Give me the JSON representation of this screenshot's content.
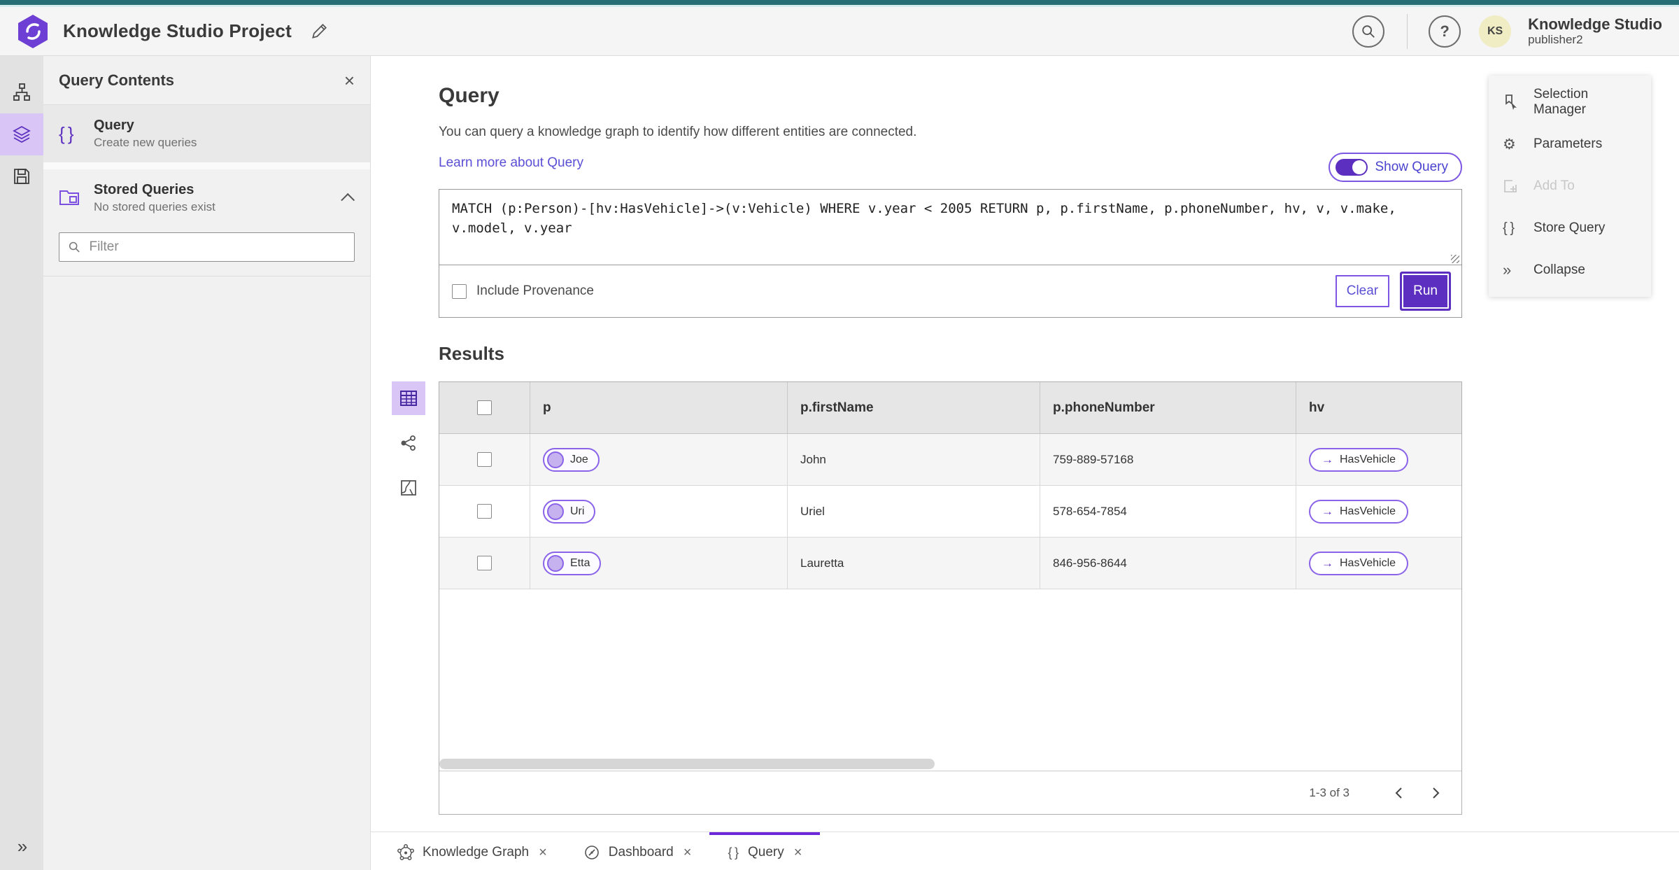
{
  "header": {
    "app_title": "Knowledge Studio Project",
    "product_name": "Knowledge Studio",
    "user_name": "publisher2",
    "avatar_initials": "KS",
    "help_glyph": "?"
  },
  "left_panel": {
    "title": "Query Contents",
    "query_item": {
      "label": "Query",
      "sublabel": "Create new queries"
    },
    "stored_item": {
      "label": "Stored Queries",
      "sublabel": "No stored queries exist"
    },
    "filter_placeholder": "Filter"
  },
  "query": {
    "title": "Query",
    "description": "You can query a knowledge graph to identify how different entities are connected.",
    "learn_more_label": "Learn more about Query",
    "show_query_label": "Show Query",
    "text": "MATCH (p:Person)-[hv:HasVehicle]->(v:Vehicle) WHERE v.year < 2005 RETURN p, p.firstName, p.phoneNumber, hv, v, v.make, v.model, v.year",
    "include_provenance_label": "Include Provenance",
    "clear_label": "Clear",
    "run_label": "Run"
  },
  "results": {
    "title": "Results",
    "columns": {
      "c1": "p",
      "c2": "p.firstName",
      "c3": "p.phoneNumber",
      "c4": "hv"
    },
    "rows": [
      {
        "p": "Joe",
        "firstName": "John",
        "phone": "759-889-57168",
        "hv": "HasVehicle"
      },
      {
        "p": "Uri",
        "firstName": "Uriel",
        "phone": "578-654-7854",
        "hv": "HasVehicle"
      },
      {
        "p": "Etta",
        "firstName": "Lauretta",
        "phone": "846-956-8644",
        "hv": "HasVehicle"
      }
    ],
    "pagination_label": "1-3 of 3"
  },
  "right_panel": {
    "selection_manager": "Selection Manager",
    "parameters": "Parameters",
    "add_to": "Add To",
    "store_query": "Store Query",
    "collapse": "Collapse"
  },
  "tabs": {
    "knowledge_graph": "Knowledge Graph",
    "dashboard": "Dashboard",
    "query": "Query"
  },
  "colors": {
    "accent_purple": "#5d2fc0",
    "accent_purple_border": "#7d57e3",
    "link_purple": "#5b4fd5",
    "teal_top": "#266d76",
    "light_purple_bg": "#d9c6f6",
    "avatar_bg": "#f0ecc4"
  }
}
